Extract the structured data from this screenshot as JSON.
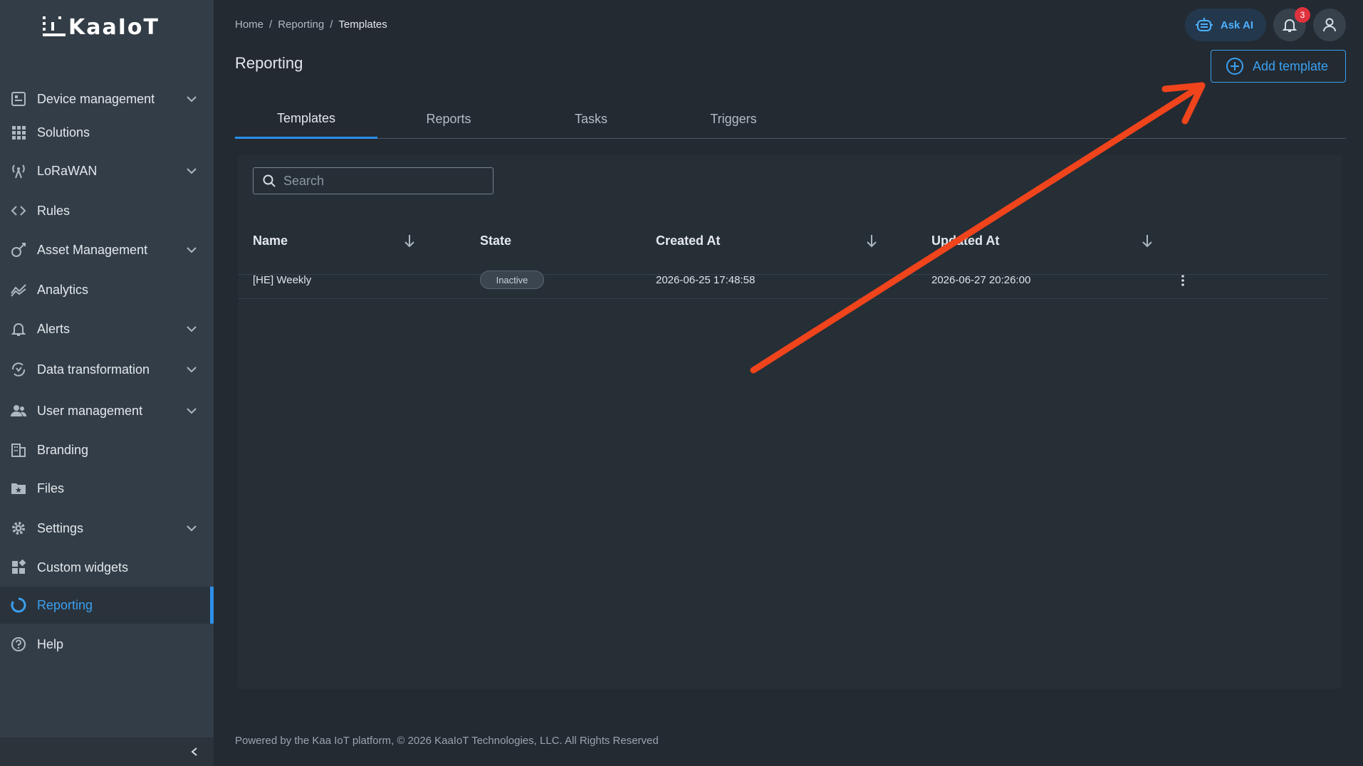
{
  "brand": {
    "logo_text": "KaaIoT"
  },
  "sidebar": {
    "items": [
      {
        "label": "Device management",
        "icon": "device-icon",
        "expandable": true
      },
      {
        "label": "Solutions",
        "icon": "grid-icon",
        "expandable": false
      },
      {
        "label": "LoRaWAN",
        "icon": "antenna-icon",
        "expandable": true
      },
      {
        "label": "Rules",
        "icon": "code-icon",
        "expandable": false
      },
      {
        "label": "Asset Management",
        "icon": "asset-icon",
        "expandable": true
      },
      {
        "label": "Analytics",
        "icon": "analytics-icon",
        "expandable": false
      },
      {
        "label": "Alerts",
        "icon": "bell-icon",
        "expandable": true
      },
      {
        "label": "Data transformation",
        "icon": "transform-icon",
        "expandable": true
      },
      {
        "label": "User management",
        "icon": "users-icon",
        "expandable": true
      },
      {
        "label": "Branding",
        "icon": "branding-icon",
        "expandable": false
      },
      {
        "label": "Files",
        "icon": "folder-icon",
        "expandable": false
      },
      {
        "label": "Settings",
        "icon": "gear-icon",
        "expandable": true
      },
      {
        "label": "Custom widgets",
        "icon": "widgets-icon",
        "expandable": false
      },
      {
        "label": "Reporting",
        "icon": "reporting-icon",
        "expandable": false,
        "active": true
      },
      {
        "label": "Help",
        "icon": "help-icon",
        "expandable": false
      }
    ]
  },
  "breadcrumb": {
    "items": [
      "Home",
      "Reporting",
      "Templates"
    ],
    "separator": "/"
  },
  "header": {
    "title": "Reporting",
    "ask_ai_label": "Ask AI",
    "notification_count": "3",
    "add_template_label": "Add template"
  },
  "tabs": [
    {
      "label": "Templates",
      "active": true
    },
    {
      "label": "Reports",
      "active": false
    },
    {
      "label": "Tasks",
      "active": false
    },
    {
      "label": "Triggers",
      "active": false
    }
  ],
  "search": {
    "placeholder": "Search",
    "value": ""
  },
  "table": {
    "columns": [
      "Name",
      "State",
      "Created At",
      "Updated At"
    ],
    "rows": [
      {
        "name": "[HE] Weekly",
        "state": "Inactive",
        "created_at": "2026-06-25 17:48:58",
        "updated_at": "2026-06-27 20:26:00"
      }
    ]
  },
  "footer": {
    "text": "Powered by the Kaa IoT platform, © 2026 KaaIoT Technologies, LLC. All Rights Reserved"
  },
  "colors": {
    "accent": "#2c8fe8",
    "annotation_arrow": "#f0441c",
    "badge": "#e0323d"
  }
}
